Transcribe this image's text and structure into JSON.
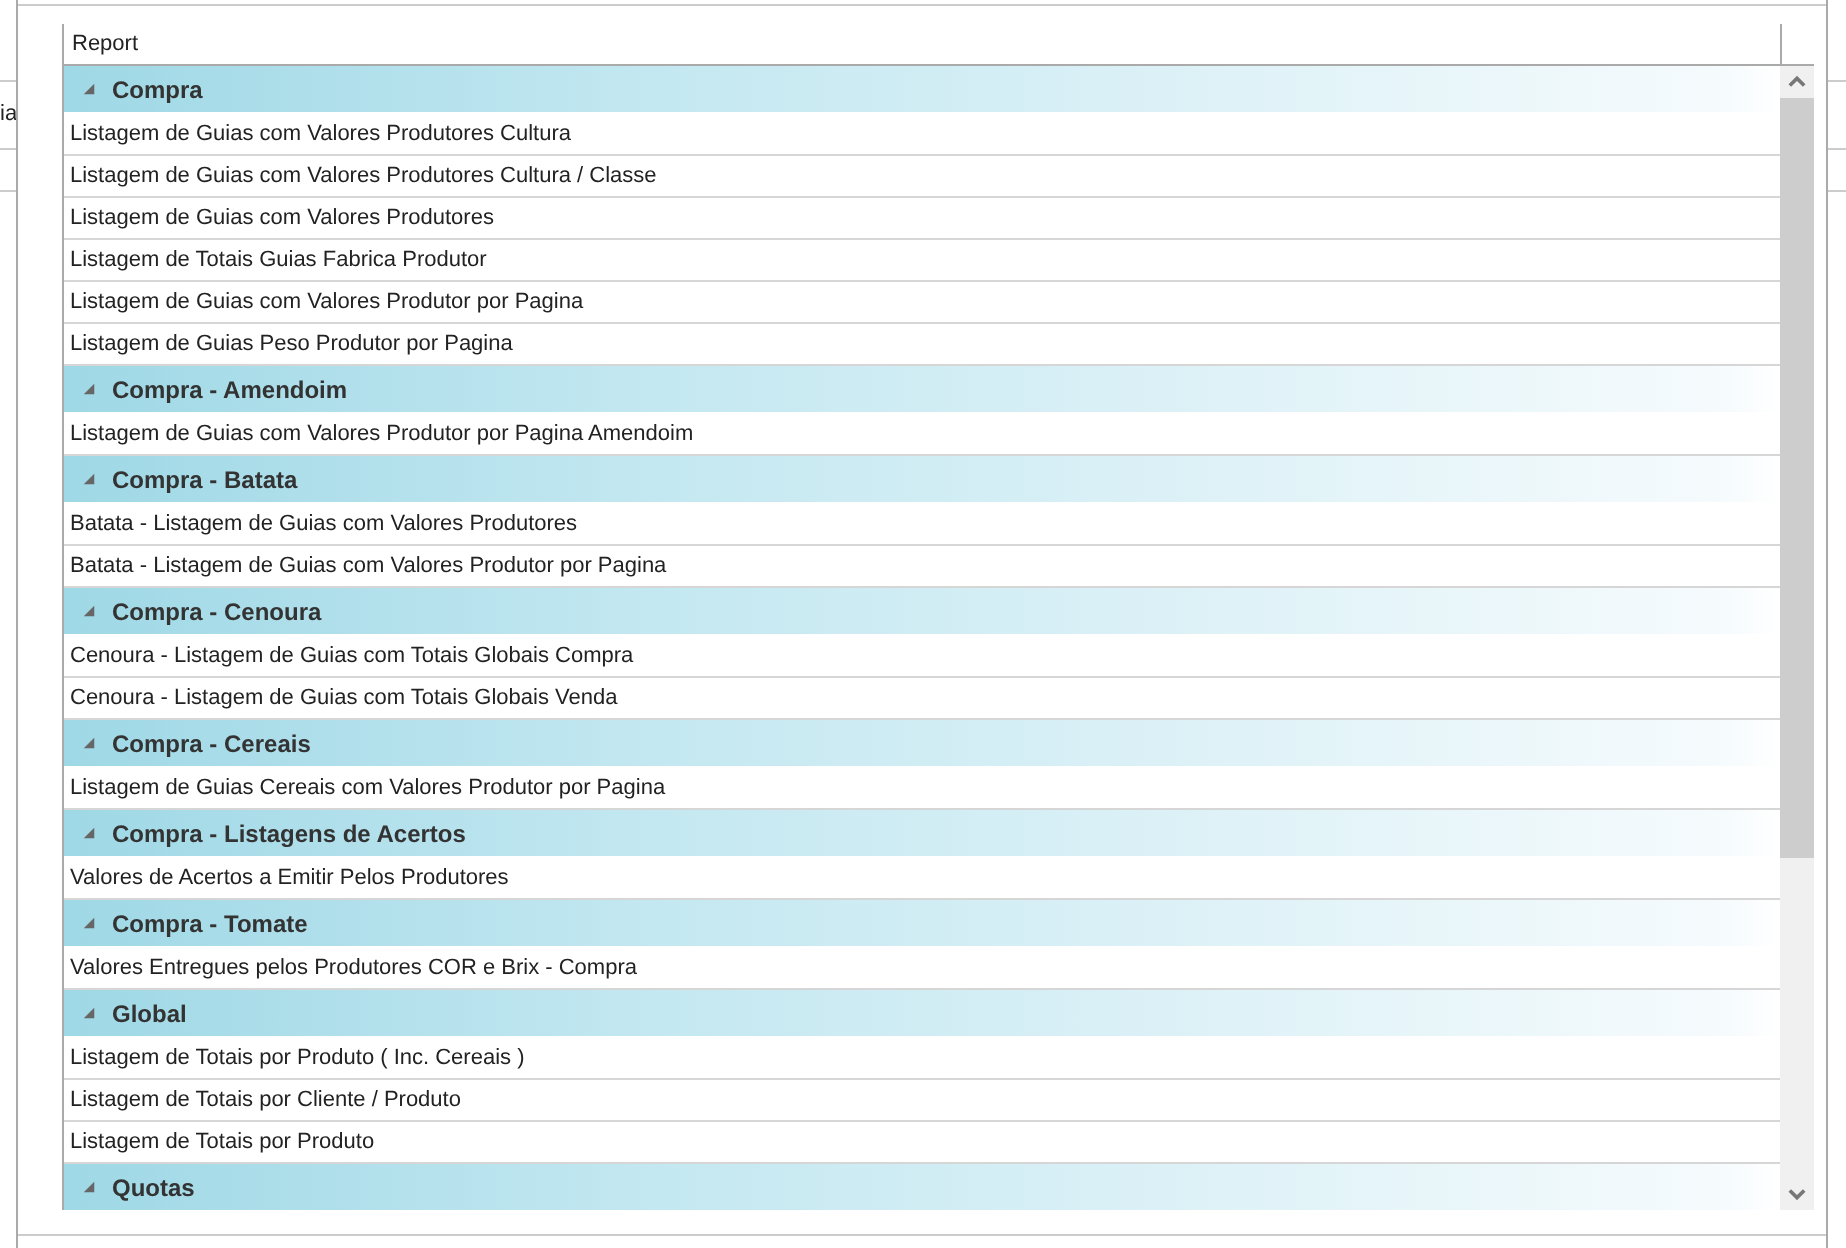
{
  "background_window": {
    "label_fragment": "ia"
  },
  "table": {
    "columns": [
      {
        "label": "Report"
      }
    ],
    "groups": [
      {
        "label": "Compra",
        "expanded": true,
        "rows": [
          "Listagem de Guias com Valores Produtores Cultura",
          "Listagem de Guias com Valores Produtores Cultura / Classe",
          "Listagem de Guias com Valores Produtores",
          "Listagem de Totais Guias Fabrica Produtor",
          "Listagem de Guias com Valores Produtor por Pagina",
          "Listagem de Guias Peso Produtor por Pagina"
        ]
      },
      {
        "label": "Compra - Amendoim",
        "expanded": true,
        "rows": [
          "Listagem de Guias com Valores Produtor por Pagina Amendoim"
        ]
      },
      {
        "label": "Compra - Batata",
        "expanded": true,
        "rows": [
          "Batata - Listagem de Guias com Valores Produtores",
          "Batata - Listagem de Guias com Valores Produtor por Pagina"
        ]
      },
      {
        "label": "Compra - Cenoura",
        "expanded": true,
        "rows": [
          "Cenoura - Listagem de Guias com Totais Globais Compra",
          "Cenoura - Listagem de Guias com Totais Globais Venda"
        ]
      },
      {
        "label": "Compra - Cereais",
        "expanded": true,
        "rows": [
          "Listagem de Guias Cereais com Valores Produtor por Pagina"
        ]
      },
      {
        "label": "Compra - Listagens de Acertos",
        "expanded": true,
        "rows": [
          "Valores de Acertos a Emitir Pelos Produtores"
        ]
      },
      {
        "label": "Compra - Tomate",
        "expanded": true,
        "rows": [
          "Valores Entregues pelos Produtores COR e Brix - Compra"
        ]
      },
      {
        "label": "Global",
        "expanded": true,
        "rows": [
          "Listagem de Totais por Produto ( Inc. Cereais )",
          "Listagem de Totais por Cliente / Produto",
          "Listagem de Totais por Produto"
        ]
      },
      {
        "label": "Quotas",
        "expanded": true
      }
    ]
  }
}
